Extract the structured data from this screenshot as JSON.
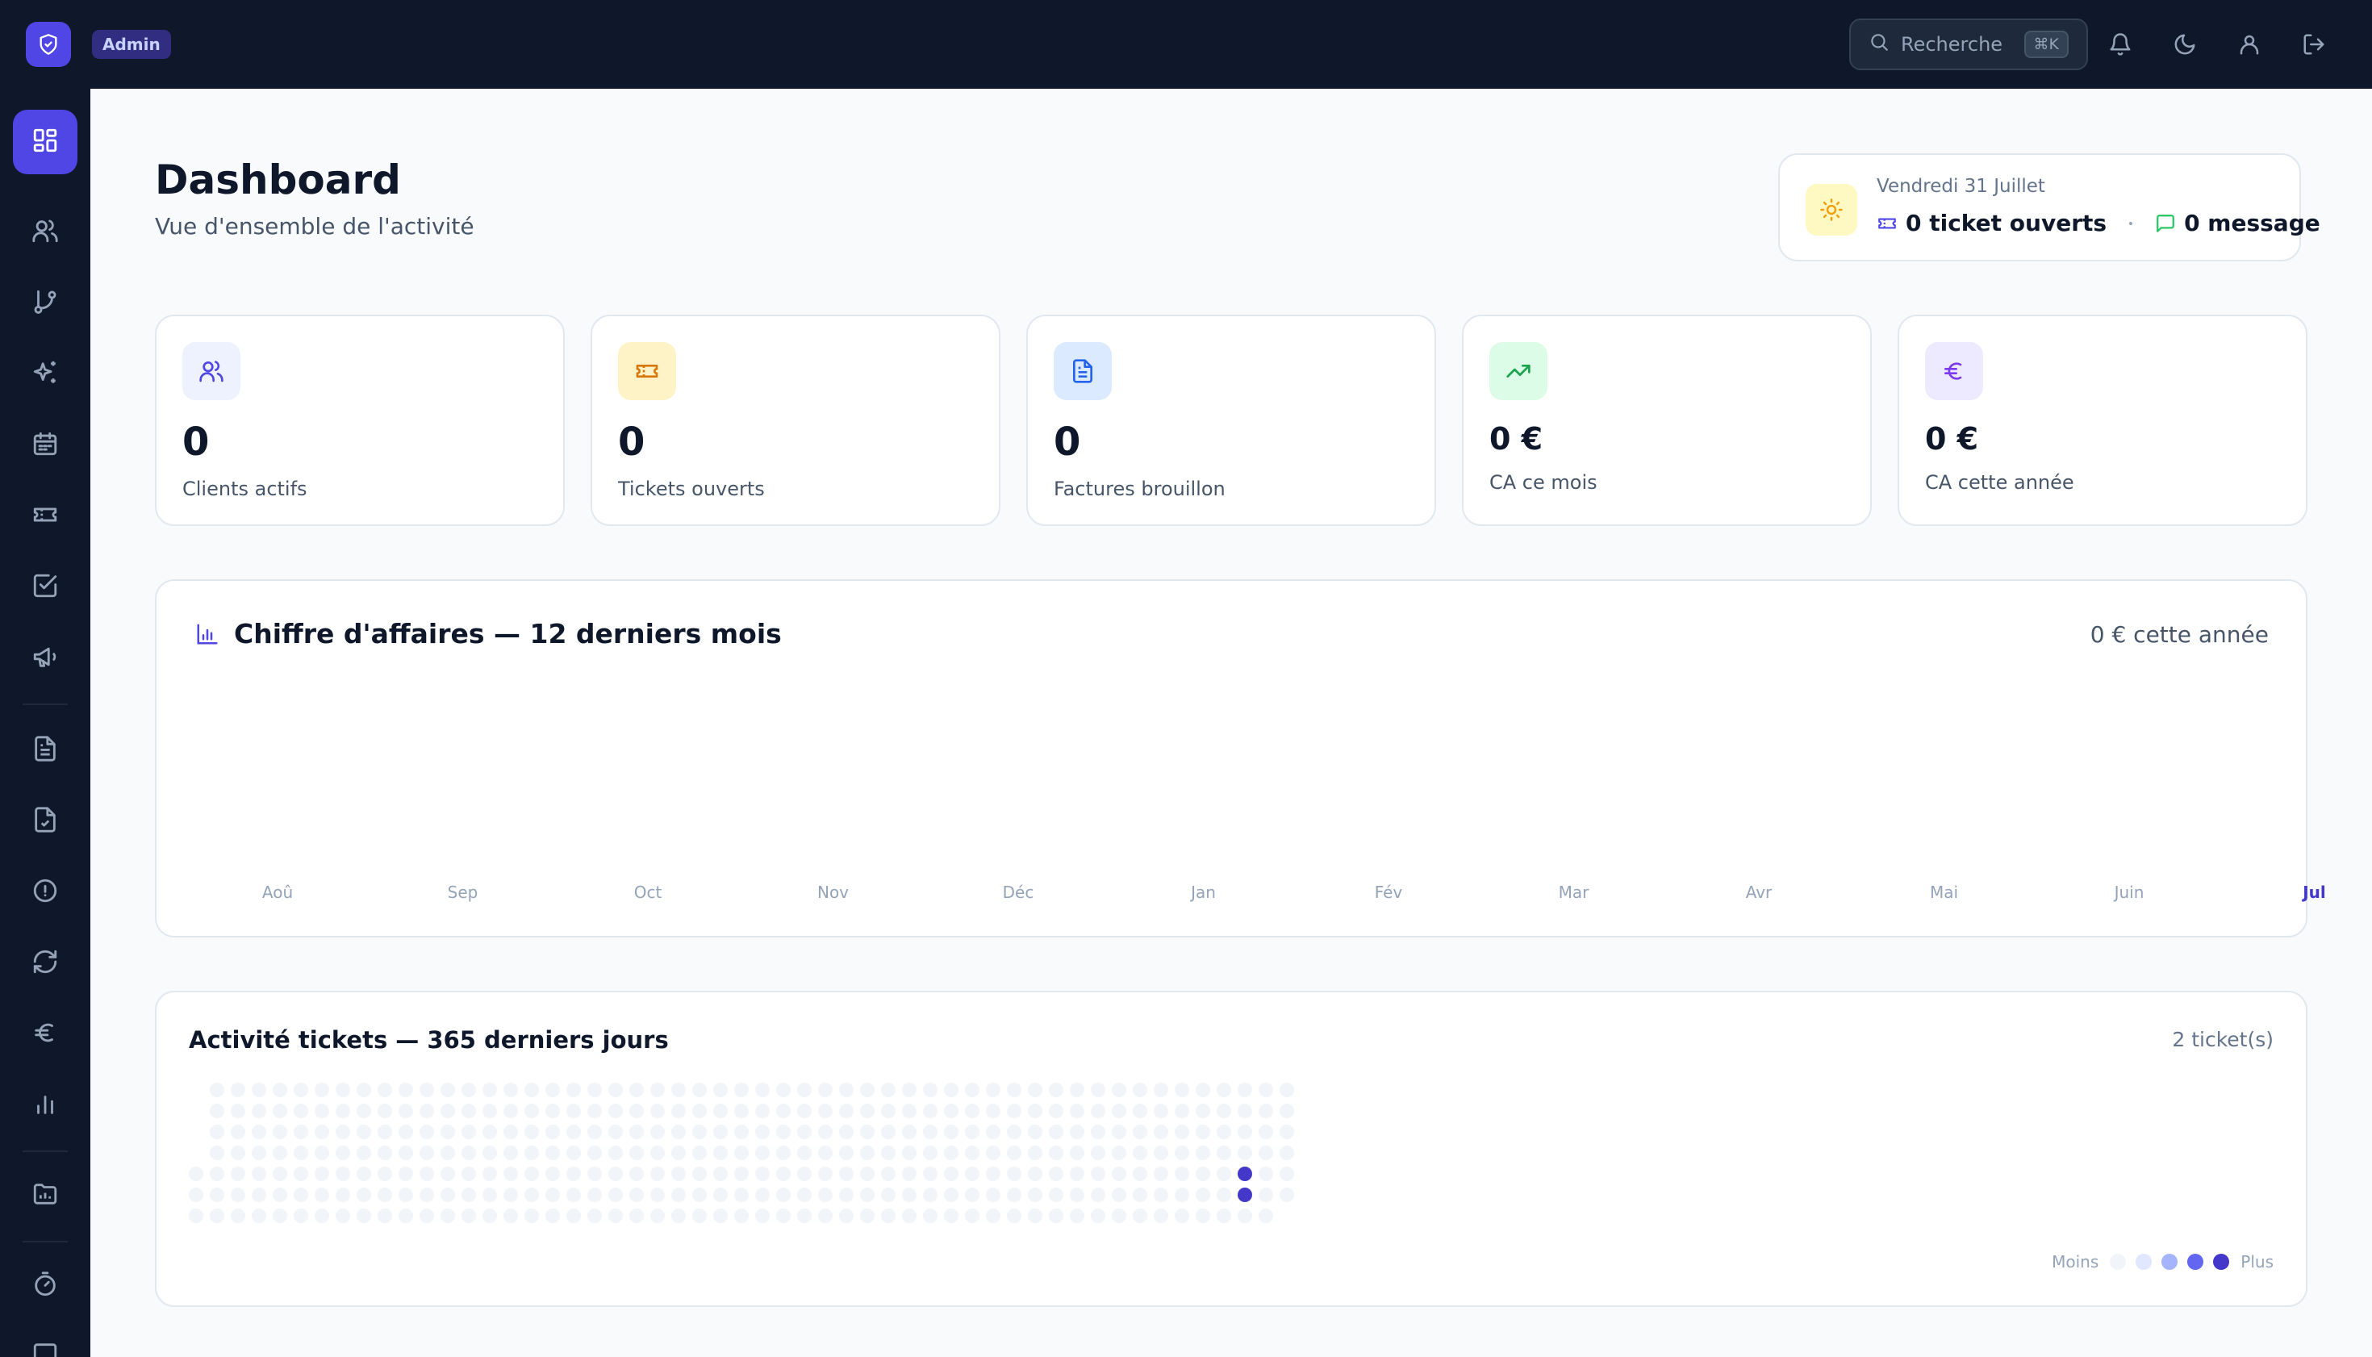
{
  "topbar": {
    "badge": "Admin",
    "search": {
      "label": "Recherche",
      "shortcut": "⌘K"
    },
    "icons": [
      "bell-icon",
      "moon-icon",
      "user-icon",
      "logout-icon"
    ]
  },
  "sidebar": {
    "items": [
      {
        "icon": "dashboard-icon",
        "active": true
      },
      {
        "icon": "users-icon"
      },
      {
        "icon": "git-branch-icon"
      },
      {
        "icon": "sparkles-icon"
      },
      {
        "icon": "calendar-icon"
      },
      {
        "icon": "ticket-icon"
      },
      {
        "icon": "check-square-icon"
      },
      {
        "icon": "megaphone-icon"
      },
      {
        "icon": "file-text-icon"
      },
      {
        "icon": "file-check-icon"
      },
      {
        "icon": "alert-circle-icon"
      },
      {
        "icon": "refresh-icon"
      },
      {
        "icon": "euro-icon"
      },
      {
        "icon": "bar-chart-icon"
      },
      {
        "icon": "folder-chart-icon"
      },
      {
        "icon": "timer-icon"
      },
      {
        "icon": "message-square-icon"
      }
    ]
  },
  "header": {
    "title": "Dashboard",
    "subtitle": "Vue d'ensemble de l'activité"
  },
  "date_card": {
    "date": "Vendredi 31 Juillet",
    "tickets": "0 ticket ouverts",
    "messages": "0 message"
  },
  "stats": [
    {
      "value": "0",
      "label": "Clients actifs",
      "icon": "users-icon",
      "accent": "#4f46e5",
      "bg": "#eef2ff"
    },
    {
      "value": "0",
      "label": "Tickets ouverts",
      "icon": "ticket-icon",
      "accent": "#d97706",
      "bg": "#fef3c7"
    },
    {
      "value": "0",
      "label": "Factures brouillon",
      "icon": "file-text-icon",
      "accent": "#2563eb",
      "bg": "#dbeafe"
    },
    {
      "value": "0 €",
      "label": "CA ce mois",
      "icon": "trending-up-icon",
      "accent": "#16a34a",
      "bg": "#dcfce7"
    },
    {
      "value": "0 €",
      "label": "CA cette année",
      "icon": "euro-icon",
      "accent": "#7c3aed",
      "bg": "#ede9fe"
    }
  ],
  "revenue": {
    "title": "Chiffre d'affaires — 12 derniers mois",
    "total": "0 € cette année",
    "months": [
      "Aoû",
      "Sep",
      "Oct",
      "Nov",
      "Déc",
      "Jan",
      "Fév",
      "Mar",
      "Avr",
      "Mai",
      "Juin",
      "Jul"
    ],
    "values": [
      0,
      0,
      0,
      0,
      0,
      0,
      0,
      0,
      0,
      0,
      0,
      0
    ],
    "current_month": "Jul"
  },
  "activity": {
    "title": "Activité tickets — 365 derniers jours",
    "count": "2 ticket(s)",
    "legend_less": "Moins",
    "legend_more": "Plus",
    "colors": [
      "#f1f5f9",
      "#e0e7ff",
      "#a5b4fc",
      "#6366f1",
      "#4338ca"
    ],
    "weeks": 53,
    "active_days": [
      {
        "week": 50,
        "day": 4,
        "level": 4
      },
      {
        "week": 50,
        "day": 5,
        "level": 4
      }
    ]
  }
}
